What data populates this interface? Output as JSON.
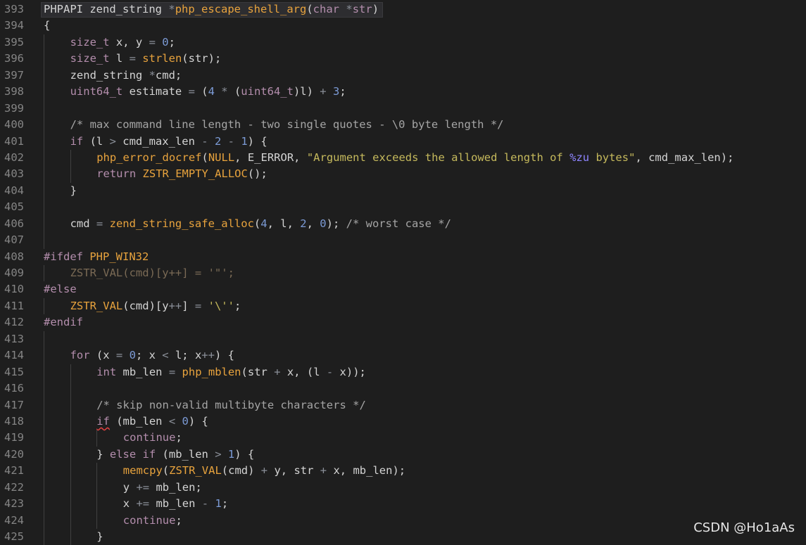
{
  "editor": {
    "lines": [
      {
        "n": "393",
        "indent": 0,
        "hl": true,
        "tokens": [
          [
            "PHPAPI",
            "plain"
          ],
          [
            " ",
            "plain"
          ],
          [
            "zend_string",
            "plain"
          ],
          [
            " ",
            "plain"
          ],
          [
            "*",
            "op"
          ],
          [
            "php_escape_shell_arg",
            "fn"
          ],
          [
            "(",
            "plain"
          ],
          [
            "char",
            "type"
          ],
          [
            " ",
            "plain"
          ],
          [
            "*",
            "op"
          ],
          [
            "str",
            "type"
          ],
          [
            ")",
            "plain"
          ]
        ]
      },
      {
        "n": "394",
        "indent": 0,
        "tokens": [
          [
            "{",
            "plain"
          ]
        ]
      },
      {
        "n": "395",
        "indent": 1,
        "tokens": [
          [
            "size_t",
            "type"
          ],
          [
            " x, y ",
            "plain"
          ],
          [
            "=",
            "op"
          ],
          [
            " ",
            "plain"
          ],
          [
            "0",
            "num"
          ],
          [
            ";",
            "plain"
          ]
        ]
      },
      {
        "n": "396",
        "indent": 1,
        "tokens": [
          [
            "size_t",
            "type"
          ],
          [
            " l ",
            "plain"
          ],
          [
            "=",
            "op"
          ],
          [
            " ",
            "plain"
          ],
          [
            "strlen",
            "fn"
          ],
          [
            "(str);",
            "plain"
          ]
        ]
      },
      {
        "n": "397",
        "indent": 1,
        "tokens": [
          [
            "zend_string ",
            "plain"
          ],
          [
            "*",
            "op"
          ],
          [
            "cmd;",
            "plain"
          ]
        ]
      },
      {
        "n": "398",
        "indent": 1,
        "tokens": [
          [
            "uint64_t",
            "type"
          ],
          [
            " estimate ",
            "plain"
          ],
          [
            "=",
            "op"
          ],
          [
            " (",
            "plain"
          ],
          [
            "4",
            "num"
          ],
          [
            " ",
            "plain"
          ],
          [
            "*",
            "op"
          ],
          [
            " (",
            "plain"
          ],
          [
            "uint64_t",
            "type"
          ],
          [
            ")l) ",
            "plain"
          ],
          [
            "+",
            "op"
          ],
          [
            " ",
            "plain"
          ],
          [
            "3",
            "num"
          ],
          [
            ";",
            "plain"
          ]
        ]
      },
      {
        "n": "399",
        "indent": 1,
        "tokens": []
      },
      {
        "n": "400",
        "indent": 1,
        "tokens": [
          [
            "/* max command line length - two single quotes - \\0 byte length */",
            "com"
          ]
        ]
      },
      {
        "n": "401",
        "indent": 1,
        "tokens": [
          [
            "if",
            "kw"
          ],
          [
            " (l ",
            "plain"
          ],
          [
            ">",
            "op"
          ],
          [
            " cmd_max_len ",
            "plain"
          ],
          [
            "-",
            "op"
          ],
          [
            " ",
            "plain"
          ],
          [
            "2",
            "num"
          ],
          [
            " ",
            "plain"
          ],
          [
            "-",
            "op"
          ],
          [
            " ",
            "plain"
          ],
          [
            "1",
            "num"
          ],
          [
            ") {",
            "plain"
          ]
        ]
      },
      {
        "n": "402",
        "indent": 2,
        "tokens": [
          [
            "php_error_docref",
            "fn"
          ],
          [
            "(",
            "plain"
          ],
          [
            "NULL",
            "macro"
          ],
          [
            ", E_ERROR, ",
            "plain"
          ],
          [
            "\"Argument exceeds the allowed length of ",
            "str"
          ],
          [
            "%zu",
            "fmt"
          ],
          [
            " bytes\"",
            "str"
          ],
          [
            ", cmd_max_len);",
            "plain"
          ]
        ]
      },
      {
        "n": "403",
        "indent": 2,
        "tokens": [
          [
            "return",
            "kw"
          ],
          [
            " ",
            "plain"
          ],
          [
            "ZSTR_EMPTY_ALLOC",
            "macro"
          ],
          [
            "();",
            "plain"
          ]
        ]
      },
      {
        "n": "404",
        "indent": 1,
        "tokens": [
          [
            "}",
            "plain"
          ]
        ]
      },
      {
        "n": "405",
        "indent": 1,
        "tokens": []
      },
      {
        "n": "406",
        "indent": 1,
        "tokens": [
          [
            "cmd ",
            "plain"
          ],
          [
            "=",
            "op"
          ],
          [
            " ",
            "plain"
          ],
          [
            "zend_string_safe_alloc",
            "fn"
          ],
          [
            "(",
            "plain"
          ],
          [
            "4",
            "num"
          ],
          [
            ", l, ",
            "plain"
          ],
          [
            "2",
            "num"
          ],
          [
            ", ",
            "plain"
          ],
          [
            "0",
            "num"
          ],
          [
            "); ",
            "plain"
          ],
          [
            "/* worst case */",
            "com"
          ]
        ]
      },
      {
        "n": "407",
        "indent": 1,
        "tokens": []
      },
      {
        "n": "408",
        "indent": 0,
        "tokens": [
          [
            "#ifdef",
            "pp"
          ],
          [
            " ",
            "plain"
          ],
          [
            "PHP_WIN32",
            "macro"
          ]
        ]
      },
      {
        "n": "409",
        "indent": 1,
        "tokens": [
          [
            "ZSTR_VAL",
            "dim"
          ],
          [
            "(cmd)[y",
            "dim"
          ],
          [
            "++",
            "dim"
          ],
          [
            "] = ",
            "dim"
          ],
          [
            "'\"'",
            "dim"
          ],
          [
            ";",
            "dim"
          ]
        ]
      },
      {
        "n": "410",
        "indent": 0,
        "tokens": [
          [
            "#else",
            "pp"
          ]
        ]
      },
      {
        "n": "411",
        "indent": 1,
        "tokens": [
          [
            "ZSTR_VAL",
            "macro"
          ],
          [
            "(cmd)[y",
            "plain"
          ],
          [
            "++",
            "op"
          ],
          [
            "] ",
            "plain"
          ],
          [
            "=",
            "op"
          ],
          [
            " ",
            "plain"
          ],
          [
            "'\\''",
            "str"
          ],
          [
            ";",
            "plain"
          ]
        ]
      },
      {
        "n": "412",
        "indent": 0,
        "tokens": [
          [
            "#endif",
            "pp"
          ]
        ]
      },
      {
        "n": "413",
        "indent": 1,
        "tokens": []
      },
      {
        "n": "414",
        "indent": 1,
        "tokens": [
          [
            "for",
            "kw"
          ],
          [
            " (x ",
            "plain"
          ],
          [
            "=",
            "op"
          ],
          [
            " ",
            "plain"
          ],
          [
            "0",
            "num"
          ],
          [
            "; x ",
            "plain"
          ],
          [
            "<",
            "op"
          ],
          [
            " l; x",
            "plain"
          ],
          [
            "++",
            "op"
          ],
          [
            ") {",
            "plain"
          ]
        ]
      },
      {
        "n": "415",
        "indent": 2,
        "tokens": [
          [
            "int",
            "type"
          ],
          [
            " mb_len ",
            "plain"
          ],
          [
            "=",
            "op"
          ],
          [
            " ",
            "plain"
          ],
          [
            "php_mblen",
            "fn"
          ],
          [
            "(str ",
            "plain"
          ],
          [
            "+",
            "op"
          ],
          [
            " x, (l ",
            "plain"
          ],
          [
            "-",
            "op"
          ],
          [
            " x));",
            "plain"
          ]
        ]
      },
      {
        "n": "416",
        "indent": 2,
        "tokens": []
      },
      {
        "n": "417",
        "indent": 2,
        "tokens": [
          [
            "/* skip non-valid multibyte characters */",
            "com"
          ]
        ]
      },
      {
        "n": "418",
        "indent": 2,
        "tokens": [
          [
            "if",
            "kw",
            "squiggle"
          ],
          [
            " (mb_len ",
            "plain"
          ],
          [
            "<",
            "op"
          ],
          [
            " ",
            "plain"
          ],
          [
            "0",
            "num"
          ],
          [
            ") {",
            "plain"
          ]
        ]
      },
      {
        "n": "419",
        "indent": 3,
        "tokens": [
          [
            "continue",
            "kw"
          ],
          [
            ";",
            "plain"
          ]
        ]
      },
      {
        "n": "420",
        "indent": 2,
        "tokens": [
          [
            "} ",
            "plain"
          ],
          [
            "else",
            "kw"
          ],
          [
            " ",
            "plain"
          ],
          [
            "if",
            "kw"
          ],
          [
            " (mb_len ",
            "plain"
          ],
          [
            ">",
            "op"
          ],
          [
            " ",
            "plain"
          ],
          [
            "1",
            "num"
          ],
          [
            ") {",
            "plain"
          ]
        ]
      },
      {
        "n": "421",
        "indent": 3,
        "tokens": [
          [
            "memcpy",
            "fn"
          ],
          [
            "(",
            "plain"
          ],
          [
            "ZSTR_VAL",
            "macro"
          ],
          [
            "(cmd) ",
            "plain"
          ],
          [
            "+",
            "op"
          ],
          [
            " y, str ",
            "plain"
          ],
          [
            "+",
            "op"
          ],
          [
            " x, mb_len);",
            "plain"
          ]
        ]
      },
      {
        "n": "422",
        "indent": 3,
        "tokens": [
          [
            "y ",
            "plain"
          ],
          [
            "+=",
            "op"
          ],
          [
            " mb_len;",
            "plain"
          ]
        ]
      },
      {
        "n": "423",
        "indent": 3,
        "tokens": [
          [
            "x ",
            "plain"
          ],
          [
            "+=",
            "op"
          ],
          [
            " mb_len ",
            "plain"
          ],
          [
            "-",
            "op"
          ],
          [
            " ",
            "plain"
          ],
          [
            "1",
            "num"
          ],
          [
            ";",
            "plain"
          ]
        ]
      },
      {
        "n": "424",
        "indent": 3,
        "tokens": [
          [
            "continue",
            "kw"
          ],
          [
            ";",
            "plain"
          ]
        ]
      },
      {
        "n": "425",
        "indent": 2,
        "tokens": [
          [
            "}",
            "plain"
          ]
        ]
      }
    ]
  },
  "watermark": "CSDN @Ho1aAs"
}
